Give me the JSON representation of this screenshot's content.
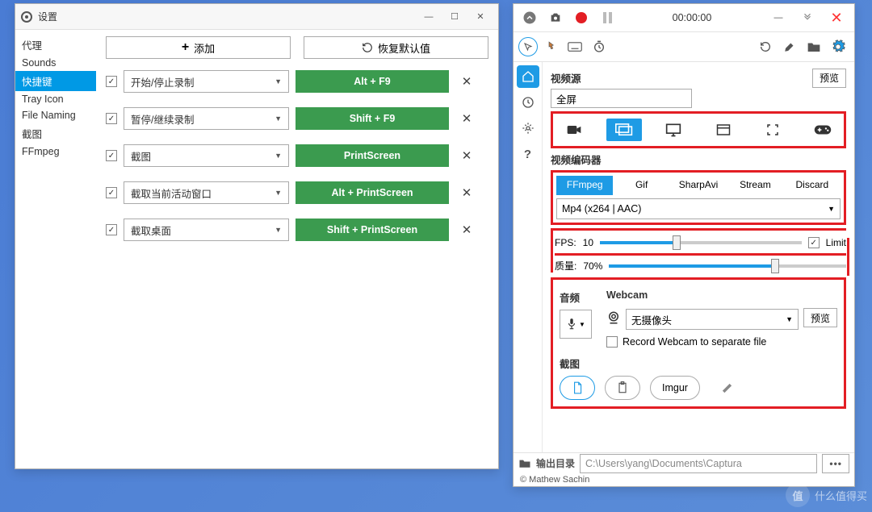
{
  "settings": {
    "title": "设置",
    "sidebar": {
      "items": [
        "代理",
        "Sounds",
        "快捷键",
        "Tray Icon",
        "File Naming",
        "截图",
        "FFmpeg"
      ],
      "selected_index": 2
    },
    "toolbar": {
      "add": "添加",
      "reset": "恢复默认值"
    },
    "hotkeys": [
      {
        "enabled": true,
        "action": "开始/停止录制",
        "key": "Alt + F9"
      },
      {
        "enabled": true,
        "action": "暂停/继续录制",
        "key": "Shift + F9"
      },
      {
        "enabled": true,
        "action": "截图",
        "key": "PrintScreen"
      },
      {
        "enabled": true,
        "action": "截取当前活动窗口",
        "key": "Alt + PrintScreen"
      },
      {
        "enabled": true,
        "action": "截取桌面",
        "key": "Shift + PrintScreen"
      }
    ]
  },
  "main": {
    "timer": "00:00:00",
    "video_source": {
      "label": "视频源",
      "value": "全屏",
      "preview": "预览"
    },
    "encoder": {
      "label": "视频编码器",
      "tabs": [
        "FFmpeg",
        "Gif",
        "SharpAvi",
        "Stream",
        "Discard"
      ],
      "selected_tab": 0,
      "preset": "Mp4 (x264 | AAC)"
    },
    "fps": {
      "label": "FPS:",
      "value": "10",
      "limit_checked": true,
      "limit_label": "Limit"
    },
    "quality": {
      "label": "质量:",
      "value": "70%"
    },
    "audio": {
      "label": "音频"
    },
    "webcam": {
      "label": "Webcam",
      "device": "无摄像头",
      "preview": "预览",
      "separate_label": "Record Webcam to separate file",
      "separate_checked": false
    },
    "screenshot": {
      "label": "截图",
      "imgur": "Imgur"
    },
    "footer": {
      "output_label": "输出目录",
      "output_path": "C:\\Users\\yang\\Documents\\Captura",
      "more": "•••"
    },
    "copyright": "© Mathew Sachin"
  },
  "watermark": {
    "circle": "值",
    "text": "什么值得买"
  }
}
